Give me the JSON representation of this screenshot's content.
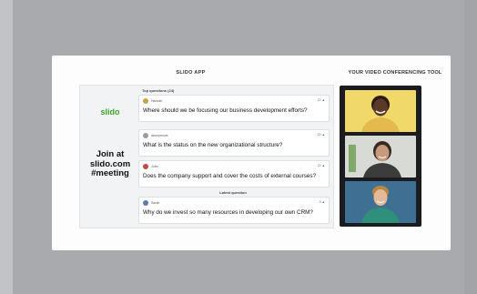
{
  "slido_app": {
    "section_title": "SLIDO APP",
    "logo_text": "slido",
    "join_lines": [
      "Join at",
      "slido.com",
      "#meeting"
    ],
    "top_questions_label": "Top questions (24)",
    "latest_question_label": "Latest question",
    "questions": [
      {
        "author": "Hannah",
        "likes": "22",
        "text": "Where should we be focusing our business development efforts?",
        "avatar_color": "#c8a04a"
      },
      {
        "author": "Anonymous",
        "likes": "20",
        "text": "What is the status on the new organizational structure?",
        "avatar_color": "#9a9ca1"
      },
      {
        "author": "John",
        "likes": "22",
        "text": "Does the company support and cover the costs of external courses?",
        "avatar_color": "#c24a3a"
      },
      {
        "author": "Sarah",
        "likes": "3",
        "text": "Why do we invest so many resources in developing our own CRM?",
        "avatar_color": "#5b7ab3"
      }
    ]
  },
  "video_tool": {
    "section_title": "YOUR VIDEO CONFERENCING TOOL",
    "participants": [
      {
        "label": "participant-1",
        "bg": "#f1d86a",
        "skin": "#5a3a26",
        "shirt": "#e4b94e"
      },
      {
        "label": "participant-2",
        "bg": "#d8dbd5",
        "skin": "#c79a7e",
        "shirt": "#3d3c3c"
      },
      {
        "label": "participant-3",
        "bg": "#3f6f92",
        "skin": "#e3b99a",
        "shirt": "#2e8f7a"
      }
    ]
  },
  "colors": {
    "brand_green": "#3aa52a",
    "background": "#a9aaad",
    "video_frame": "#1b1c1f"
  }
}
